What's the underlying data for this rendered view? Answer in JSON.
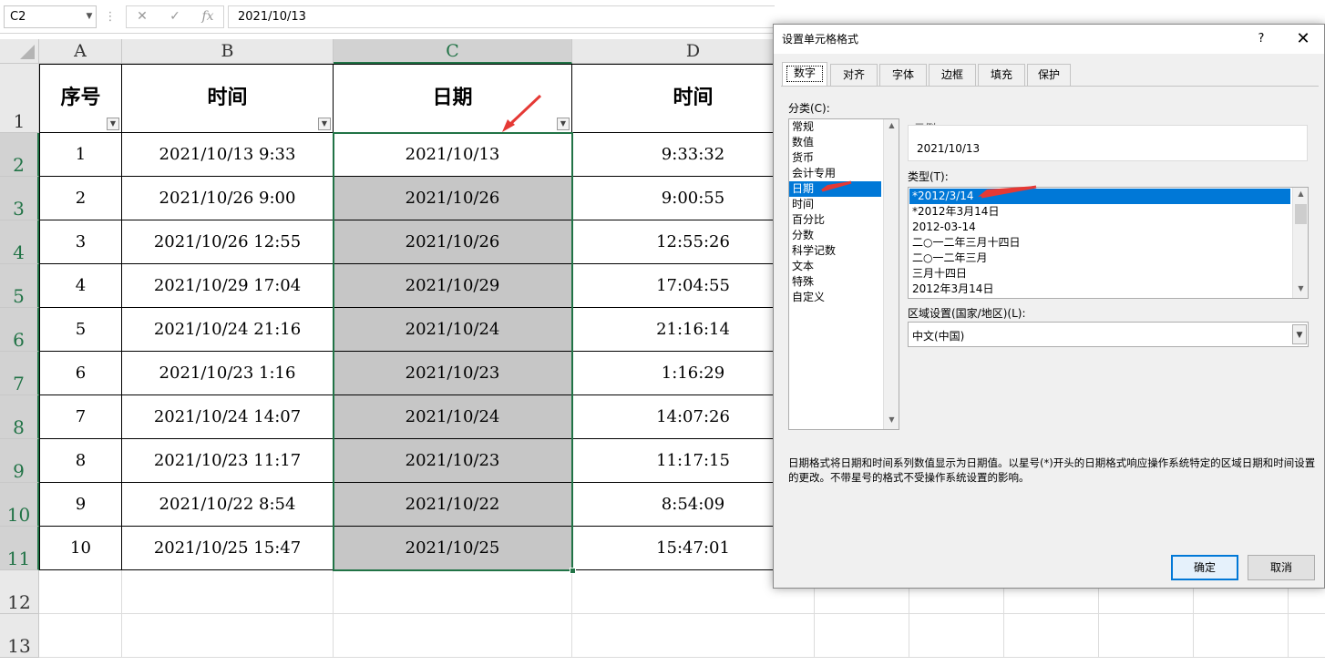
{
  "formula_bar": {
    "name_box": "C2",
    "formula": "2021/10/13",
    "cancel_glyph": "✕",
    "enter_glyph": "✓",
    "fx_glyph": "fx"
  },
  "columns": [
    "A",
    "B",
    "C",
    "D"
  ],
  "rows": [
    "1",
    "2",
    "3",
    "4",
    "5",
    "6",
    "7",
    "8",
    "9",
    "10",
    "11",
    "12",
    "13"
  ],
  "table": {
    "headers": [
      "序号",
      "时间",
      "日期",
      "时间"
    ],
    "rows": [
      [
        "1",
        "2021/10/13 9:33",
        "2021/10/13",
        "9:33:32"
      ],
      [
        "2",
        "2021/10/26 9:00",
        "2021/10/26",
        "9:00:55"
      ],
      [
        "3",
        "2021/10/26 12:55",
        "2021/10/26",
        "12:55:26"
      ],
      [
        "4",
        "2021/10/29 17:04",
        "2021/10/29",
        "17:04:55"
      ],
      [
        "5",
        "2021/10/24 21:16",
        "2021/10/24",
        "21:16:14"
      ],
      [
        "6",
        "2021/10/23 1:16",
        "2021/10/23",
        "1:16:29"
      ],
      [
        "7",
        "2021/10/24 14:07",
        "2021/10/24",
        "14:07:26"
      ],
      [
        "8",
        "2021/10/23 11:17",
        "2021/10/23",
        "11:17:15"
      ],
      [
        "9",
        "2021/10/22 8:54",
        "2021/10/22",
        "8:54:09"
      ],
      [
        "10",
        "2021/10/25 15:47",
        "2021/10/25",
        "15:47:01"
      ]
    ]
  },
  "dialog": {
    "title": "设置单元格格式",
    "help": "?",
    "close": "✕",
    "tabs": [
      "数字",
      "对齐",
      "字体",
      "边框",
      "填充",
      "保护"
    ],
    "category_label": "分类(C):",
    "categories": [
      "常规",
      "数值",
      "货币",
      "会计专用",
      "日期",
      "时间",
      "百分比",
      "分数",
      "科学记数",
      "文本",
      "特殊",
      "自定义"
    ],
    "selected_category": "日期",
    "sample_label": "示例",
    "sample_value": "2021/10/13",
    "type_label": "类型(T):",
    "types": [
      "*2012/3/14",
      "*2012年3月14日",
      "2012-03-14",
      "二○一二年三月十四日",
      "二○一二年三月",
      "三月十四日",
      "2012年3月14日"
    ],
    "locale_label": "区域设置(国家/地区)(L):",
    "locale_value": "中文(中国)",
    "description": "日期格式将日期和时间系列数值显示为日期值。以星号(*)开头的日期格式响应操作系统特定的区域日期和时间设置的更改。不带星号的格式不受操作系统设置的影响。",
    "ok_label": "确定",
    "cancel_label": "取消"
  },
  "colors": {
    "selection_green": "#217346",
    "list_highlight": "#0078d7",
    "arrow_red": "#e53935"
  }
}
